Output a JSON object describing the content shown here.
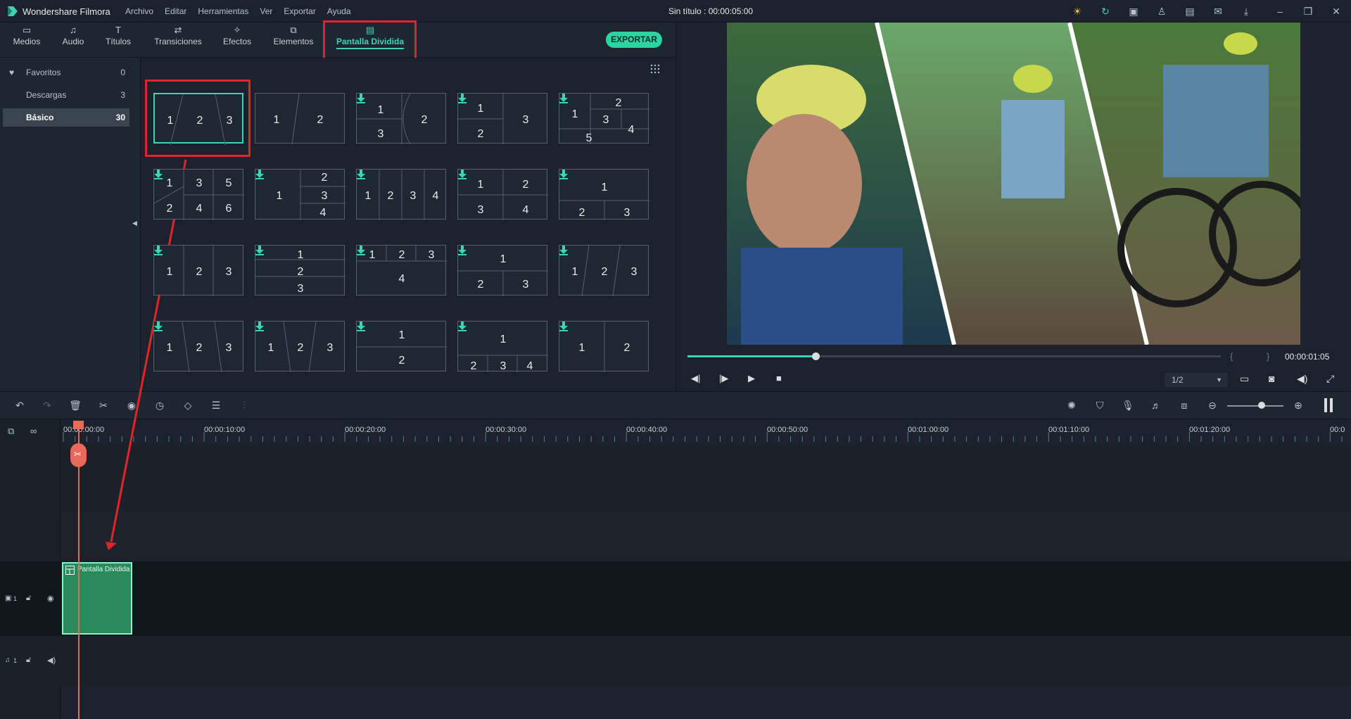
{
  "app": {
    "name": "Wondershare Filmora",
    "document_title": "Sin título : 00:00:05:00"
  },
  "menu": [
    "Archivo",
    "Editar",
    "Herramientas",
    "Ver",
    "Exportar",
    "Ayuda"
  ],
  "toolbar": {
    "tabs": [
      {
        "label": "Medios",
        "icon": "folder-icon"
      },
      {
        "label": "Audio",
        "icon": "music-note-icon"
      },
      {
        "label": "Títulos",
        "icon": "text-icon"
      },
      {
        "label": "Transiciones",
        "icon": "transition-icon"
      },
      {
        "label": "Efectos",
        "icon": "effects-icon"
      },
      {
        "label": "Elementos",
        "icon": "elements-icon"
      },
      {
        "label": "Pantalla Dividida",
        "icon": "split-screen-icon",
        "active": true
      }
    ],
    "export_label": "EXPORTAR"
  },
  "sidebar": {
    "items": [
      {
        "label": "Favoritos",
        "count": "0",
        "icon": "heart-icon"
      },
      {
        "label": "Descargas",
        "count": "3"
      },
      {
        "label": "Básico",
        "count": "30",
        "selected": true
      }
    ]
  },
  "split_tiles": [
    {
      "cells": [
        "1",
        "2",
        "3"
      ],
      "download": false,
      "selected": true
    },
    {
      "cells": [
        "1",
        "2"
      ],
      "download": false
    },
    {
      "cells": [
        "1",
        "3",
        "2"
      ],
      "download": true
    },
    {
      "cells": [
        "1",
        "2",
        "3"
      ],
      "download": true
    },
    {
      "cells": [
        "1",
        "2",
        "3",
        "5",
        "4"
      ],
      "download": true
    },
    {
      "cells": [
        "1",
        "3",
        "5",
        "2",
        "4",
        "6"
      ],
      "download": true
    },
    {
      "cells": [
        "1",
        "2",
        "3",
        "4"
      ],
      "download": true
    },
    {
      "cells": [
        "1",
        "2",
        "3",
        "4"
      ],
      "download": true
    },
    {
      "cells": [
        "1",
        "2",
        "3",
        "4"
      ],
      "download": true
    },
    {
      "cells": [
        "1",
        "2",
        "3"
      ],
      "download": true
    },
    {
      "cells": [
        "1",
        "2",
        "3"
      ],
      "download": true
    },
    {
      "cells": [
        "1",
        "2",
        "3"
      ],
      "download": true
    },
    {
      "cells": [
        "1",
        "2",
        "3",
        "4"
      ],
      "download": true
    },
    {
      "cells": [
        "1",
        "2",
        "3"
      ],
      "download": true
    },
    {
      "cells": [
        "1",
        "2",
        "3"
      ],
      "download": true
    },
    {
      "cells": [
        "1",
        "2",
        "3"
      ],
      "download": true
    },
    {
      "cells": [
        "1",
        "2",
        "3"
      ],
      "download": true
    },
    {
      "cells": [
        "1",
        "2"
      ],
      "download": true
    },
    {
      "cells": [
        "1",
        "2",
        "3",
        "4"
      ],
      "download": true
    },
    {
      "cells": [
        "1",
        "2"
      ],
      "download": true
    }
  ],
  "preview": {
    "timecode": "00:00:01:05",
    "quality": "1/2",
    "progress": 0.24,
    "brackets": "{ }"
  },
  "timeline": {
    "ruler_labels": [
      "00:00:00:00",
      "00:00:10:00",
      "00:00:20:00",
      "00:00:30:00",
      "00:00:40:00",
      "00:00:50:00",
      "00:01:00:00",
      "00:01:10:00",
      "00:01:20:00",
      "00:0"
    ],
    "clip_label": "Pantalla Dividida",
    "video_track_label": "1",
    "audio_track_label": "1"
  },
  "colors": {
    "accent": "#3fd3b1",
    "annotation": "#e2242a",
    "clip": "#2a8a5c",
    "playhead": "#e8685a"
  }
}
